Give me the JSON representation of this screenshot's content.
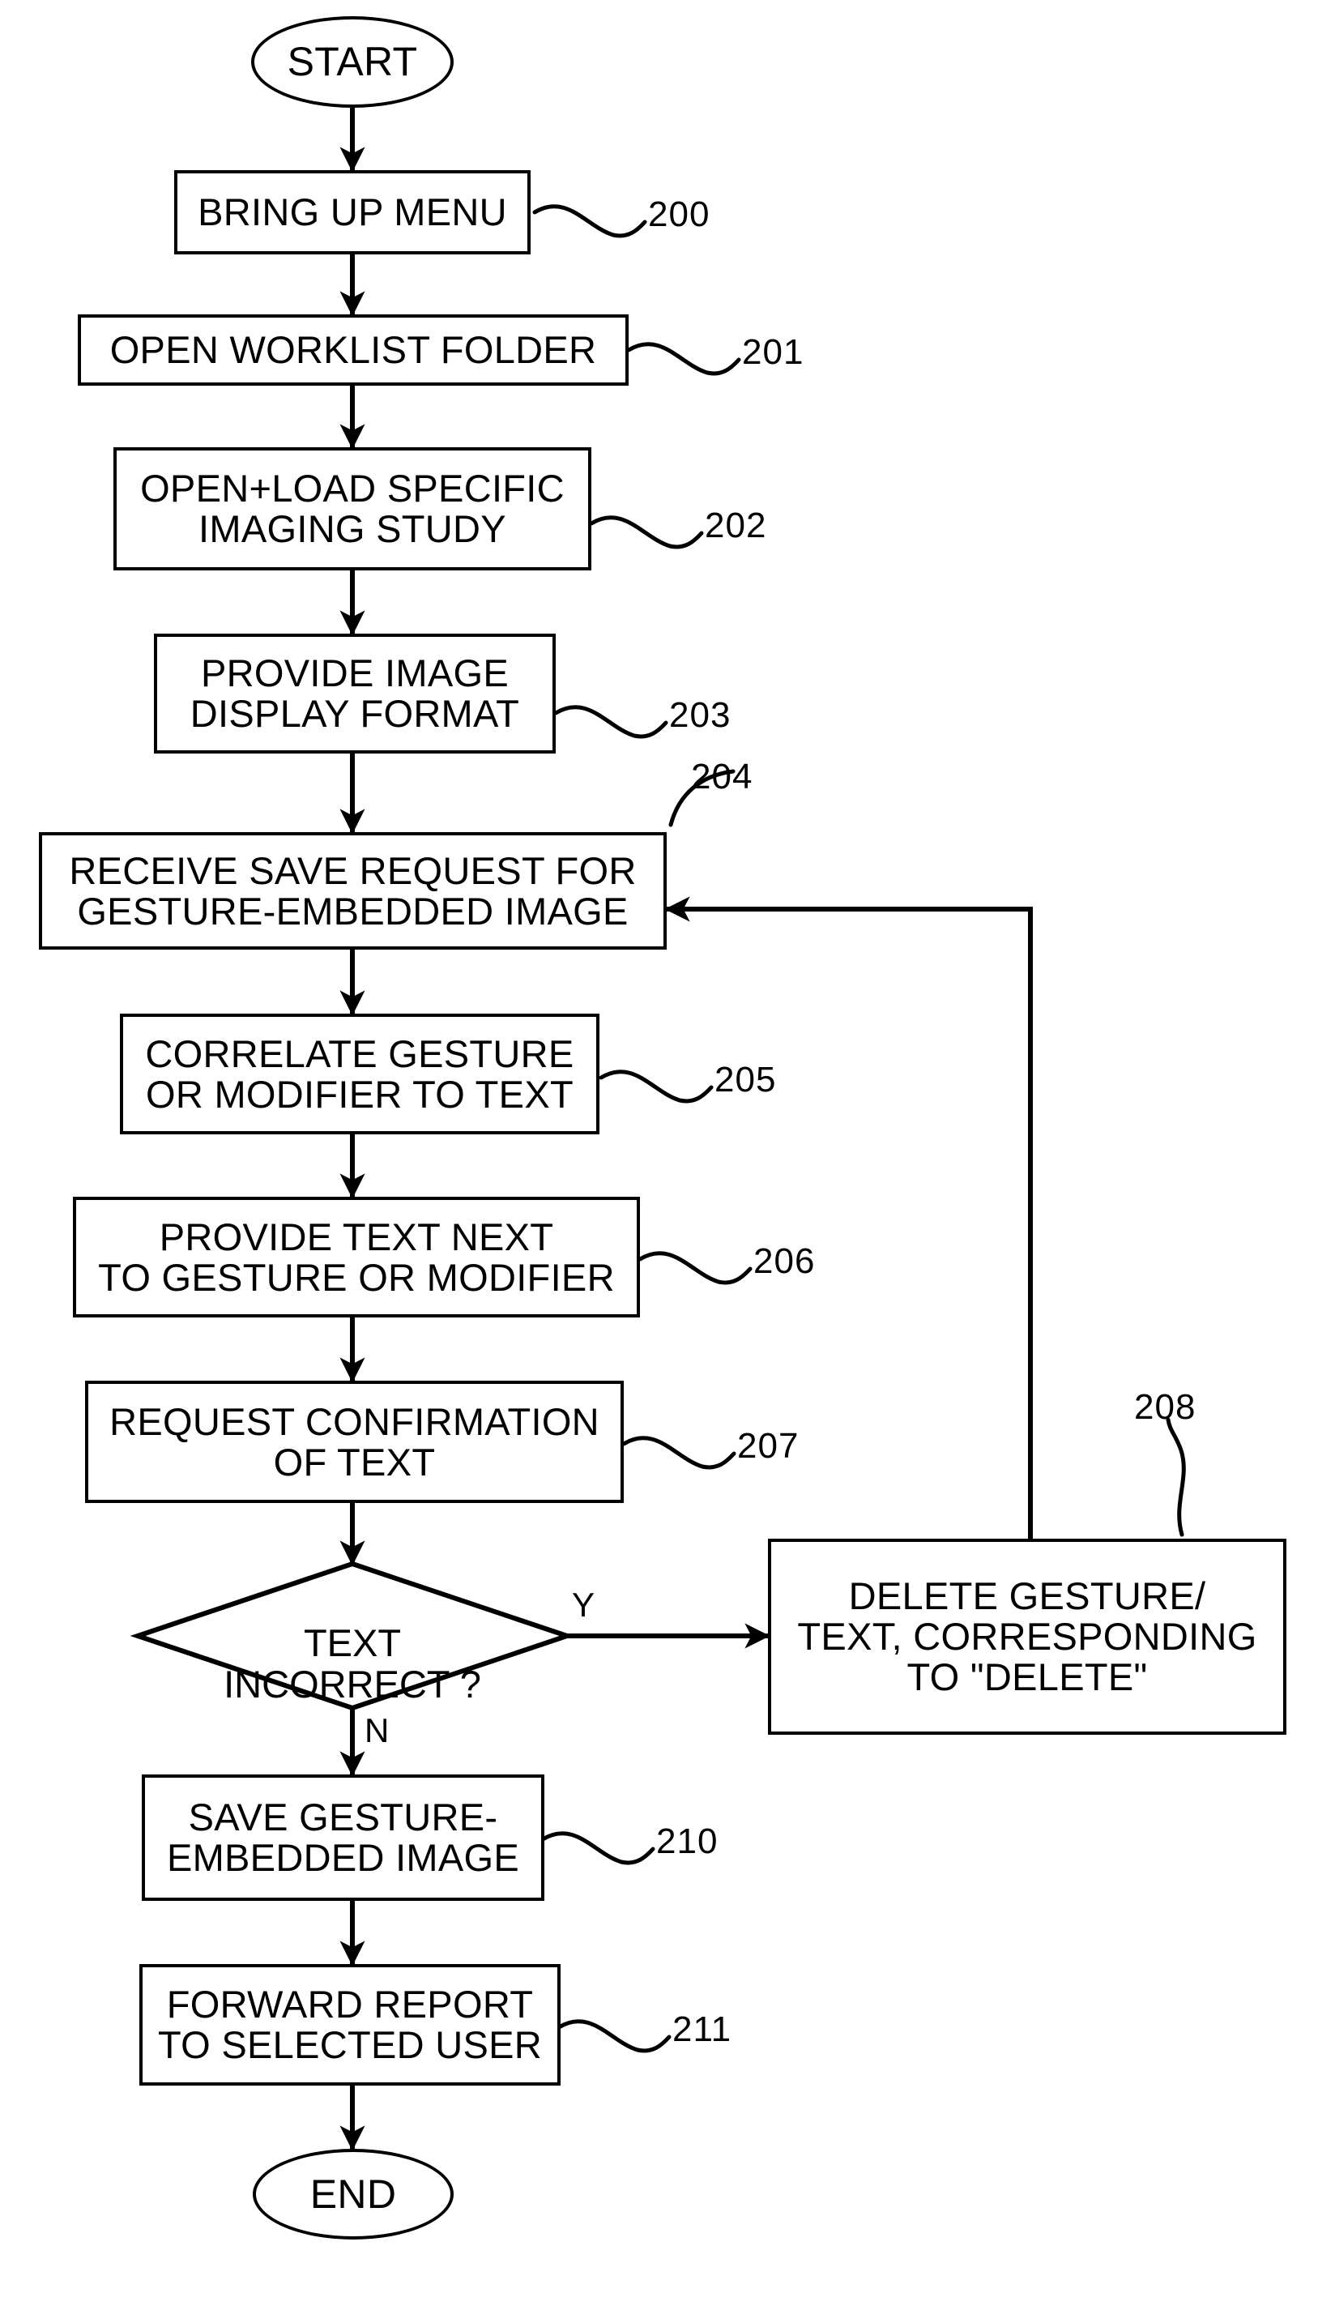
{
  "figure": {
    "type": "flowchart",
    "terminators": {
      "start": "START",
      "end": "END"
    },
    "nodes": [
      {
        "id": "start",
        "shape": "ellipse",
        "label": "START",
        "ref": ""
      },
      {
        "id": "n200",
        "shape": "process",
        "label": "BRING UP MENU",
        "ref": "200"
      },
      {
        "id": "n201",
        "shape": "process",
        "label": "OPEN WORKLIST FOLDER",
        "ref": "201"
      },
      {
        "id": "n202",
        "shape": "process",
        "label": "OPEN+LOAD SPECIFIC\nIMAGING STUDY",
        "ref": "202"
      },
      {
        "id": "n203",
        "shape": "process",
        "label": "PROVIDE IMAGE\nDISPLAY FORMAT",
        "ref": "203"
      },
      {
        "id": "n204",
        "shape": "process",
        "label": "RECEIVE SAVE REQUEST FOR\nGESTURE-EMBEDDED IMAGE",
        "ref": "204"
      },
      {
        "id": "n205",
        "shape": "process",
        "label": "CORRELATE GESTURE\nOR MODIFIER TO TEXT",
        "ref": "205"
      },
      {
        "id": "n206",
        "shape": "process",
        "label": "PROVIDE TEXT NEXT\nTO GESTURE OR MODIFIER",
        "ref": "206"
      },
      {
        "id": "n207",
        "shape": "process",
        "label": "REQUEST CONFIRMATION\nOF TEXT",
        "ref": "207"
      },
      {
        "id": "n209",
        "shape": "decision",
        "label": "TEXT\nINCORRECT ?",
        "ref": ""
      },
      {
        "id": "n208",
        "shape": "process",
        "label": "DELETE GESTURE/\nTEXT, CORRESPONDING\nTO \"DELETE\"",
        "ref": "208"
      },
      {
        "id": "n210",
        "shape": "process",
        "label": "SAVE GESTURE-\nEMBEDDED IMAGE",
        "ref": "210"
      },
      {
        "id": "n211",
        "shape": "process",
        "label": "FORWARD REPORT\nTO SELECTED USER",
        "ref": "211"
      },
      {
        "id": "end",
        "shape": "ellipse",
        "label": "END",
        "ref": ""
      }
    ],
    "reference_numerals": [
      "200",
      "201",
      "202",
      "203",
      "204",
      "205",
      "206",
      "207",
      "208",
      "210",
      "211"
    ],
    "branch_labels": {
      "yes": "Y",
      "no": "N"
    },
    "edges": [
      {
        "from": "start",
        "to": "n200",
        "label": ""
      },
      {
        "from": "n200",
        "to": "n201",
        "label": ""
      },
      {
        "from": "n201",
        "to": "n202",
        "label": ""
      },
      {
        "from": "n202",
        "to": "n203",
        "label": ""
      },
      {
        "from": "n203",
        "to": "n204",
        "label": ""
      },
      {
        "from": "n204",
        "to": "n205",
        "label": ""
      },
      {
        "from": "n205",
        "to": "n206",
        "label": ""
      },
      {
        "from": "n206",
        "to": "n207",
        "label": ""
      },
      {
        "from": "n207",
        "to": "n209",
        "label": ""
      },
      {
        "from": "n209",
        "to": "n208",
        "label": "Y"
      },
      {
        "from": "n209",
        "to": "n210",
        "label": "N"
      },
      {
        "from": "n208",
        "to": "n204",
        "label": ""
      },
      {
        "from": "n210",
        "to": "n211",
        "label": ""
      },
      {
        "from": "n211",
        "to": "end",
        "label": ""
      }
    ],
    "colors": {
      "ink": "#000000",
      "paper": "#ffffff"
    }
  }
}
